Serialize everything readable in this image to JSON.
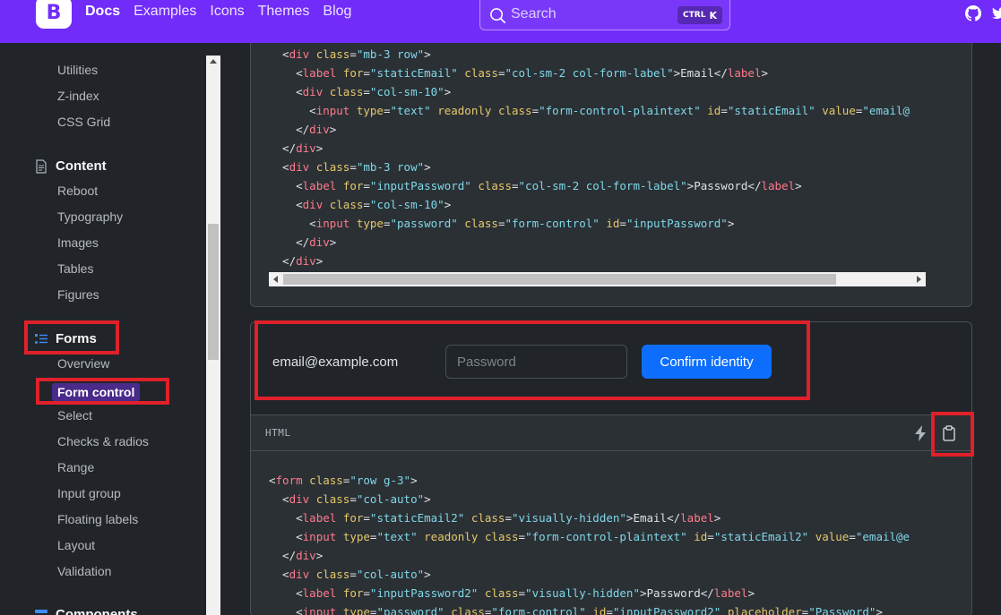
{
  "navbar": {
    "logo": "B",
    "links": [
      "Docs",
      "Examples",
      "Icons",
      "Themes",
      "Blog"
    ],
    "search": {
      "placeholder": "Search",
      "shortcut_mod": "CTRL",
      "shortcut_key": "K"
    }
  },
  "sidebar": {
    "top_links": [
      "Utilities",
      "Z-index",
      "CSS Grid"
    ],
    "content": {
      "heading": "Content",
      "links": [
        "Reboot",
        "Typography",
        "Images",
        "Tables",
        "Figures"
      ]
    },
    "forms": {
      "heading": "Forms",
      "links": [
        "Overview",
        "Form control",
        "Select",
        "Checks & radios",
        "Range",
        "Input group",
        "Floating labels",
        "Layout",
        "Validation"
      ],
      "active": "Form control"
    },
    "next_heading": "Components"
  },
  "example": {
    "static_email": "email@example.com",
    "password_placeholder": "Password",
    "button_label": "Confirm identity",
    "code_header": "HTML"
  },
  "colors": {
    "brand": "#712cf9",
    "primary": "#0d6efd",
    "highlight": "#e0202a"
  },
  "icons": [
    "search-icon",
    "github-icon",
    "twitter-icon",
    "file-icon",
    "list-icon",
    "bolt-icon",
    "clipboard-icon"
  ]
}
